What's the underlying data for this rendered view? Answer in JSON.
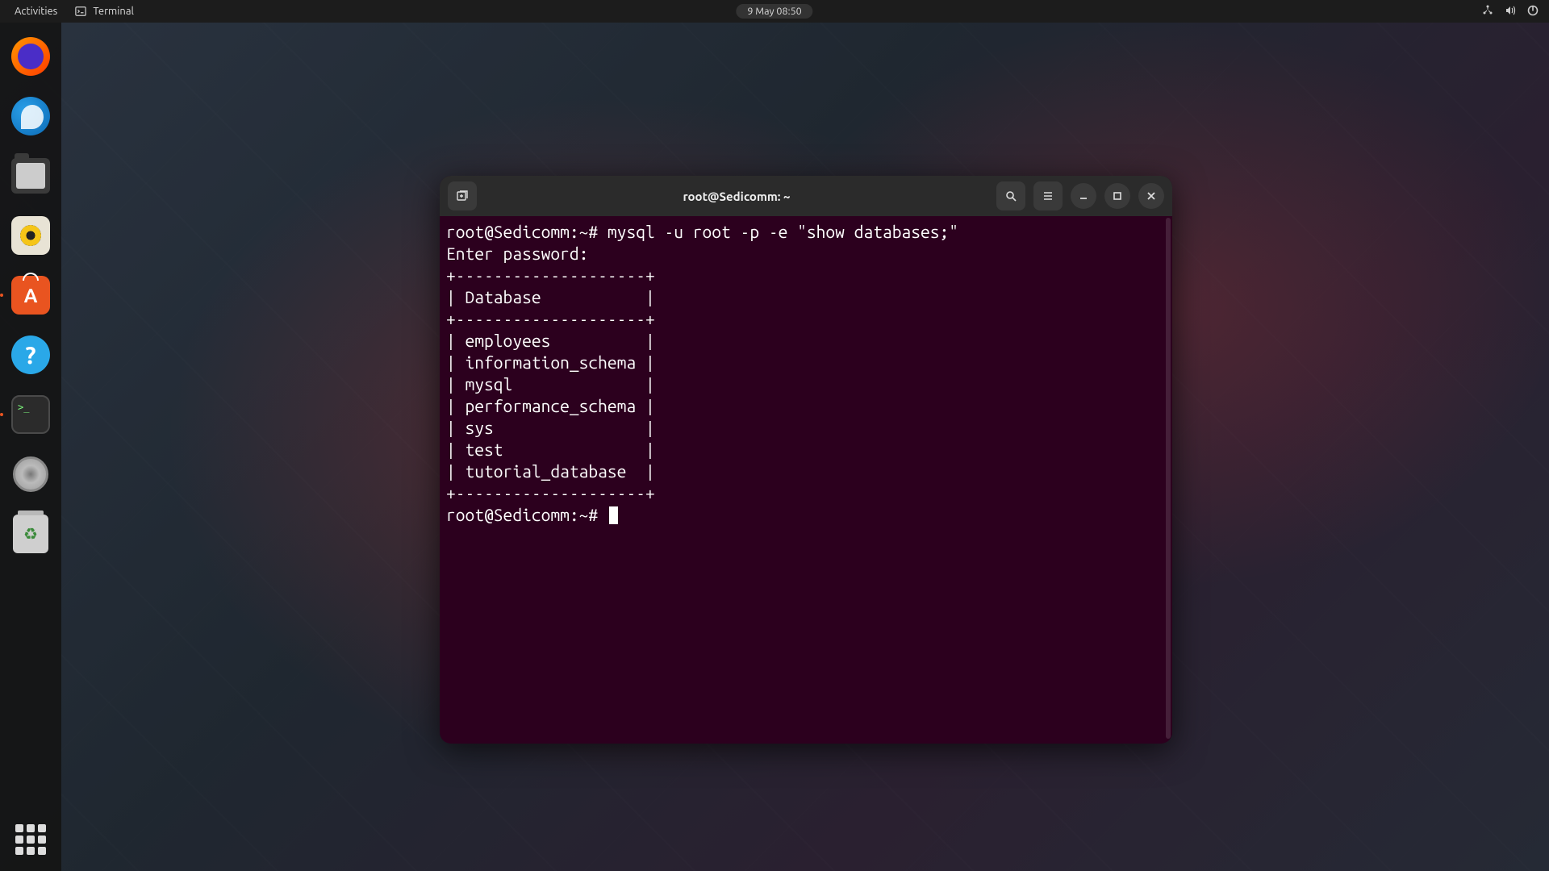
{
  "topbar": {
    "activities": "Activities",
    "app_name": "Terminal",
    "clock": "9 May  08:50"
  },
  "dock": {
    "items": [
      {
        "name": "firefox"
      },
      {
        "name": "thunderbird"
      },
      {
        "name": "files"
      },
      {
        "name": "rhythmbox"
      },
      {
        "name": "ubuntu-software"
      },
      {
        "name": "help"
      },
      {
        "name": "terminal"
      },
      {
        "name": "disc"
      },
      {
        "name": "trash"
      }
    ]
  },
  "terminal": {
    "title": "root@Sedicomm: ~",
    "prompt1": "root@Sedicomm:~# ",
    "command": "mysql -u root -p -e \"show databases;\"",
    "line_enter_pw": "Enter password:",
    "table_border": "+--------------------+",
    "table_header": "| Database           |",
    "rows": [
      "| employees          |",
      "| information_schema |",
      "| mysql              |",
      "| performance_schema |",
      "| sys                |",
      "| test               |",
      "| tutorial_database  |"
    ],
    "prompt2": "root@Sedicomm:~# "
  },
  "terminal_prompt_token": ">_"
}
